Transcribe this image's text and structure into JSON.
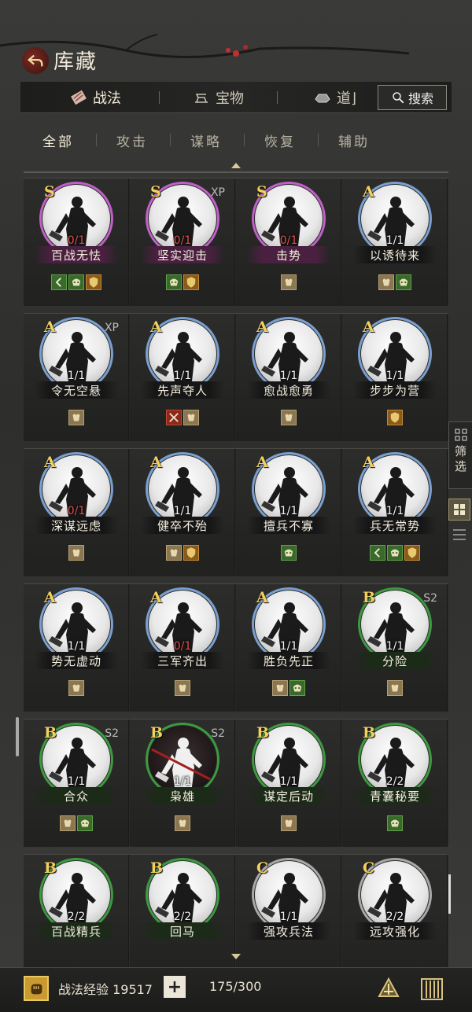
{
  "header": {
    "title": "库藏"
  },
  "tabs": [
    {
      "label": "战法",
      "icon": "scroll-icon",
      "active": true
    },
    {
      "label": "宝物",
      "icon": "anvil-icon",
      "active": false
    },
    {
      "label": "道⌋",
      "icon": "ingot-icon",
      "active": false
    }
  ],
  "search": {
    "label": "搜索"
  },
  "filters": [
    {
      "label": "全部",
      "active": true
    },
    {
      "label": "攻击",
      "active": false
    },
    {
      "label": "谋略",
      "active": false
    },
    {
      "label": "恢复",
      "active": false
    },
    {
      "label": "辅助",
      "active": false
    }
  ],
  "cards": [
    {
      "grade": "S",
      "tag": "",
      "count": "0/1",
      "name": "百战无怯",
      "badges": [
        "arrow",
        "bag-green",
        "shield"
      ],
      "dark": false
    },
    {
      "grade": "S",
      "tag": "XP",
      "count": "0/1",
      "name": "坚实迎击",
      "badges": [
        "bag-green",
        "shield"
      ],
      "dark": false
    },
    {
      "grade": "S",
      "tag": "",
      "count": "0/1",
      "name": "击势",
      "badges": [
        "bag"
      ],
      "dark": false
    },
    {
      "grade": "A",
      "tag": "",
      "count": "1/1",
      "name": "以诱待来",
      "badges": [
        "bag",
        "bag-green"
      ],
      "dark": false
    },
    {
      "grade": "A",
      "tag": "XP",
      "count": "1/1",
      "name": "令无空悬",
      "badges": [
        "bag"
      ],
      "dark": false
    },
    {
      "grade": "A",
      "tag": "",
      "count": "1/1",
      "name": "先声夺人",
      "badges": [
        "swords",
        "bag"
      ],
      "dark": false
    },
    {
      "grade": "A",
      "tag": "",
      "count": "1/1",
      "name": "愈战愈勇",
      "badges": [
        "bag"
      ],
      "dark": false
    },
    {
      "grade": "A",
      "tag": "",
      "count": "1/1",
      "name": "步步为营",
      "badges": [
        "shield"
      ],
      "dark": false
    },
    {
      "grade": "A",
      "tag": "",
      "count": "0/1",
      "name": "深谋远虑",
      "badges": [
        "bag"
      ],
      "dark": false
    },
    {
      "grade": "A",
      "tag": "",
      "count": "1/1",
      "name": "健卒不殆",
      "badges": [
        "bag",
        "shield"
      ],
      "dark": false
    },
    {
      "grade": "A",
      "tag": "",
      "count": "1/1",
      "name": "擅兵不寡",
      "badges": [
        "bag-green"
      ],
      "dark": false
    },
    {
      "grade": "A",
      "tag": "",
      "count": "1/1",
      "name": "兵无常势",
      "badges": [
        "arrow",
        "bag-green",
        "shield"
      ],
      "dark": false
    },
    {
      "grade": "A",
      "tag": "",
      "count": "1/1",
      "name": "势无虚动",
      "badges": [
        "bag"
      ],
      "dark": false
    },
    {
      "grade": "A",
      "tag": "",
      "count": "0/1",
      "name": "三军齐出",
      "badges": [
        "bag"
      ],
      "dark": false
    },
    {
      "grade": "A",
      "tag": "",
      "count": "1/1",
      "name": "胜负先正",
      "badges": [
        "bag",
        "bag-green"
      ],
      "dark": false
    },
    {
      "grade": "B",
      "tag": "S2",
      "count": "1/1",
      "name": "分险",
      "badges": [
        "bag"
      ],
      "dark": false
    },
    {
      "grade": "B",
      "tag": "S2",
      "count": "1/1",
      "name": "合众",
      "badges": [
        "bag",
        "bag-green"
      ],
      "dark": false
    },
    {
      "grade": "B",
      "tag": "S2",
      "count": "1/1",
      "name": "枭雄",
      "badges": [
        "bag"
      ],
      "dark": true
    },
    {
      "grade": "B",
      "tag": "",
      "count": "1/1",
      "name": "谋定后动",
      "badges": [
        "bag"
      ],
      "dark": false
    },
    {
      "grade": "B",
      "tag": "",
      "count": "2/2",
      "name": "青囊秘要",
      "badges": [
        "bag-green"
      ],
      "dark": false
    },
    {
      "grade": "B",
      "tag": "",
      "count": "2/2",
      "name": "百战精兵",
      "badges": [],
      "dark": false
    },
    {
      "grade": "B",
      "tag": "",
      "count": "2/2",
      "name": "回马",
      "badges": [],
      "dark": false
    },
    {
      "grade": "C",
      "tag": "",
      "count": "1/1",
      "name": "强攻兵法",
      "badges": [],
      "dark": false
    },
    {
      "grade": "C",
      "tag": "",
      "count": "2/2",
      "name": "远攻强化",
      "badges": [],
      "dark": false
    }
  ],
  "side": {
    "filter_label": "筛选"
  },
  "footer": {
    "exp_label": "战法经验 19517",
    "plus": "+",
    "capacity": "175/300"
  },
  "colors": {
    "grade_S": "#c060c8",
    "grade_A": "#7aa0d0",
    "grade_B": "#3c9a40",
    "grade_C": "#a8a8a8",
    "zero_count": "#e05050",
    "grade_letter": "#f2d060"
  }
}
